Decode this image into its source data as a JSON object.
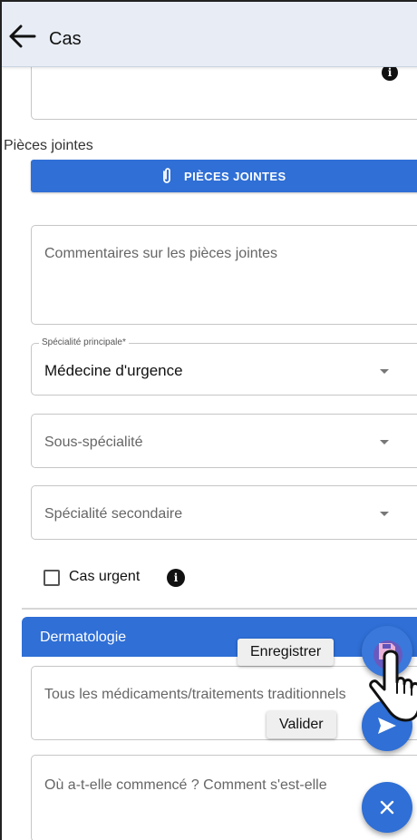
{
  "appbar": {
    "title": "Cas"
  },
  "attachments": {
    "section_label": "Pièces jointes",
    "button_label": "PIÈCES JOINTES"
  },
  "comments": {
    "placeholder": "Commentaires sur les pièces jointes"
  },
  "main_specialty": {
    "legend": "Spécialité principale*",
    "value": "Médecine d'urgence"
  },
  "sub_specialty": {
    "placeholder": "Sous-spécialité"
  },
  "secondary_specialty": {
    "placeholder": "Spécialité secondaire"
  },
  "urgent": {
    "label": "Cas urgent",
    "checked": false
  },
  "dermatology": {
    "title": "Dermatologie",
    "field1_placeholder": "Tous les médicaments/traitements traditionnels",
    "field2_placeholder": "Où a-t-elle commencé ? Comment s'est-elle"
  },
  "tooltips": {
    "save": "Enregistrer",
    "validate": "Valider"
  },
  "icons": {
    "back": "arrow-left-icon",
    "info": "info-icon",
    "attachment": "paperclip-icon",
    "dropdown": "chevron-down-icon",
    "save": "save-icon",
    "send": "send-icon",
    "close": "close-icon",
    "cursor": "hand-pointer-icon"
  },
  "colors": {
    "primary": "#2f6fd6",
    "appbar": "#e8edf5"
  }
}
